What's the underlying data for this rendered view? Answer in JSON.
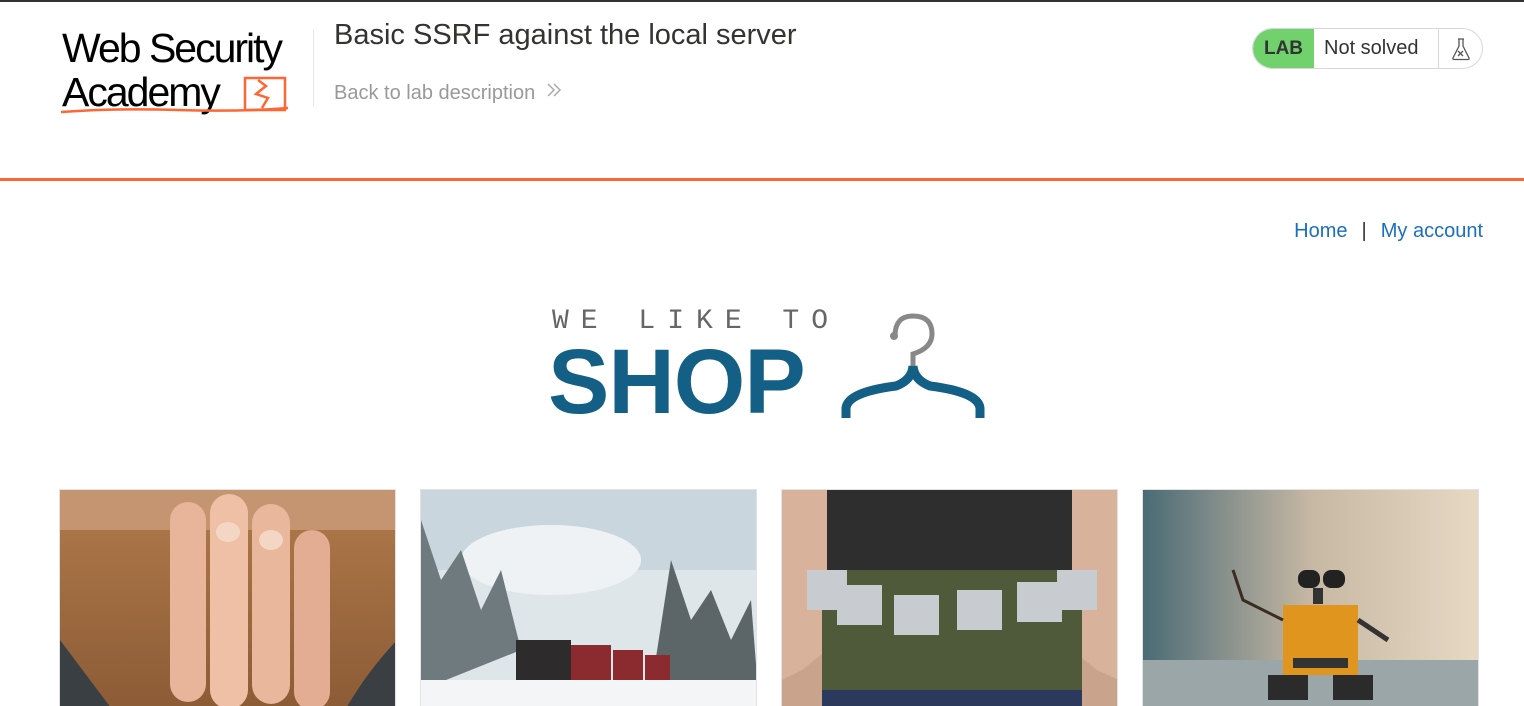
{
  "header": {
    "logo": {
      "line1": "Web Security",
      "line2": "Academy"
    },
    "lab_title": "Basic SSRF against the local server",
    "back_link": "Back to lab description",
    "status": {
      "badge": "LAB",
      "text": "Not solved",
      "icon": "flask-icon",
      "badge_color": "#70d16d"
    }
  },
  "accent_colors": {
    "orange": "#ff6633",
    "link_blue": "#1a6fbf",
    "shop_blue": "#145f85"
  },
  "nav": {
    "home": "Home",
    "separator": "|",
    "account": "My account"
  },
  "banner": {
    "small": "WE LIKE TO",
    "big": "SHOP",
    "icon": "hanger-icon"
  },
  "products": [
    {
      "image": "bearded man covering face"
    },
    {
      "image": "steam train in snowy forest"
    },
    {
      "image": "beer can belt"
    },
    {
      "image": "wall-e robot toy"
    }
  ]
}
